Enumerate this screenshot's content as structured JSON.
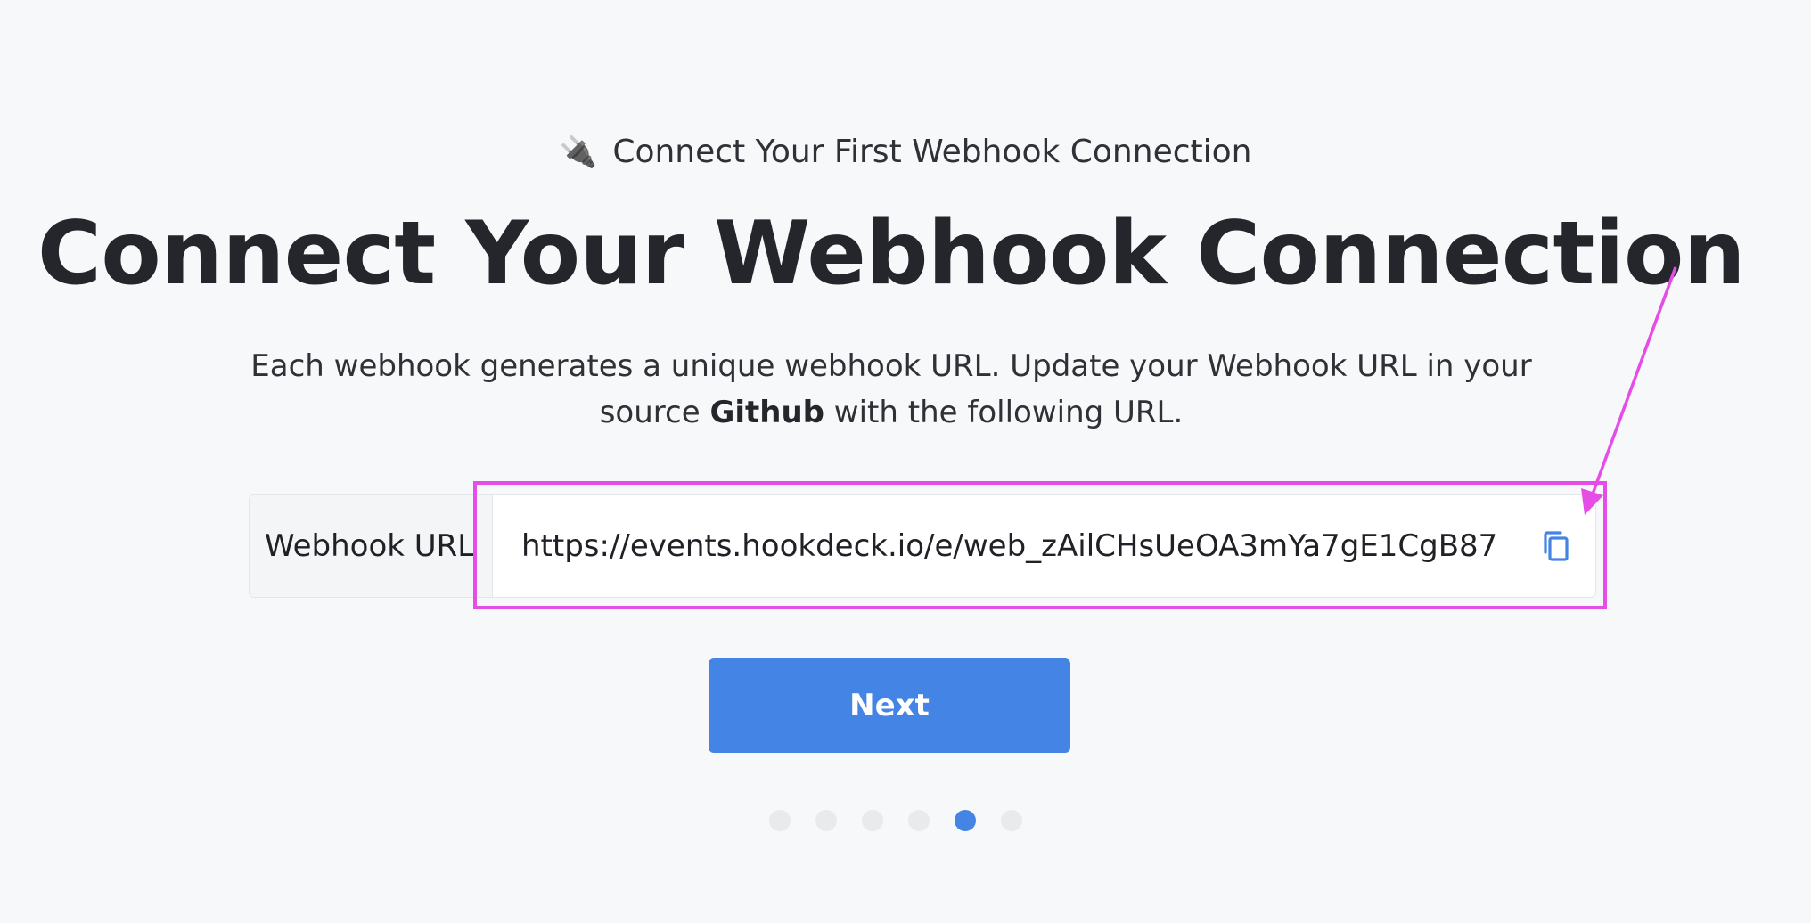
{
  "header": {
    "eyebrow_icon": "plug-icon",
    "eyebrow_emoji": "🔌",
    "eyebrow_text": "Connect Your First Webhook Connection",
    "title": "Connect Your Webhook Connection"
  },
  "description": {
    "line_start": "Each webhook generates a unique webhook URL. Update your Webhook URL in your source ",
    "source_name": "Github",
    "line_end": " with the following URL."
  },
  "webhook": {
    "label": "Webhook URL",
    "url": "https://events.hookdeck.io/e/web_zAilCHsUeOA3mYa7gE1CgB87",
    "copy_icon": "copy-icon"
  },
  "actions": {
    "next_label": "Next"
  },
  "stepper": {
    "total_steps": 6,
    "current_step": 5
  },
  "colors": {
    "accent": "#4384e4",
    "annotation": "#e64ce6",
    "background": "#f7f8fa"
  }
}
